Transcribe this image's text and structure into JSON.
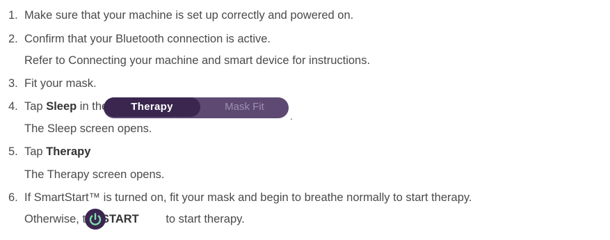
{
  "steps": [
    {
      "number": "1.",
      "text": "Make sure that your machine is set up correctly and powered on."
    },
    {
      "number": "2.",
      "text": "Confirm that your Bluetooth connection is active.",
      "note": "Refer to Connecting your machine and smart device for instructions."
    },
    {
      "number": "3.",
      "text": "Fit your mask."
    },
    {
      "number": "4.",
      "prefix": "Tap ",
      "bold": "Sleep",
      "suffix": " in the Navigation tab.",
      "note": "The Sleep screen opens."
    },
    {
      "number": "5.",
      "prefix": "Tap ",
      "bold": "Therapy",
      "suffix": ".",
      "note": "The Therapy screen opens."
    },
    {
      "number": "6.",
      "text": "If SmartStart™ is turned on, fit your mask and begin to breathe normally to start therapy.",
      "note_prefix": "Otherwise, tap ",
      "note_bold": "START",
      "note_suffix": " to start therapy."
    }
  ],
  "segmented_control": {
    "active": "Therapy",
    "inactive": "Mask Fit"
  },
  "icons": {
    "start": "power-icon"
  },
  "colors": {
    "accent": "#3b2650",
    "segment_bg": "#5e4973",
    "inactive_text": "#9d8fae",
    "body_text": "#4a4a4a"
  }
}
